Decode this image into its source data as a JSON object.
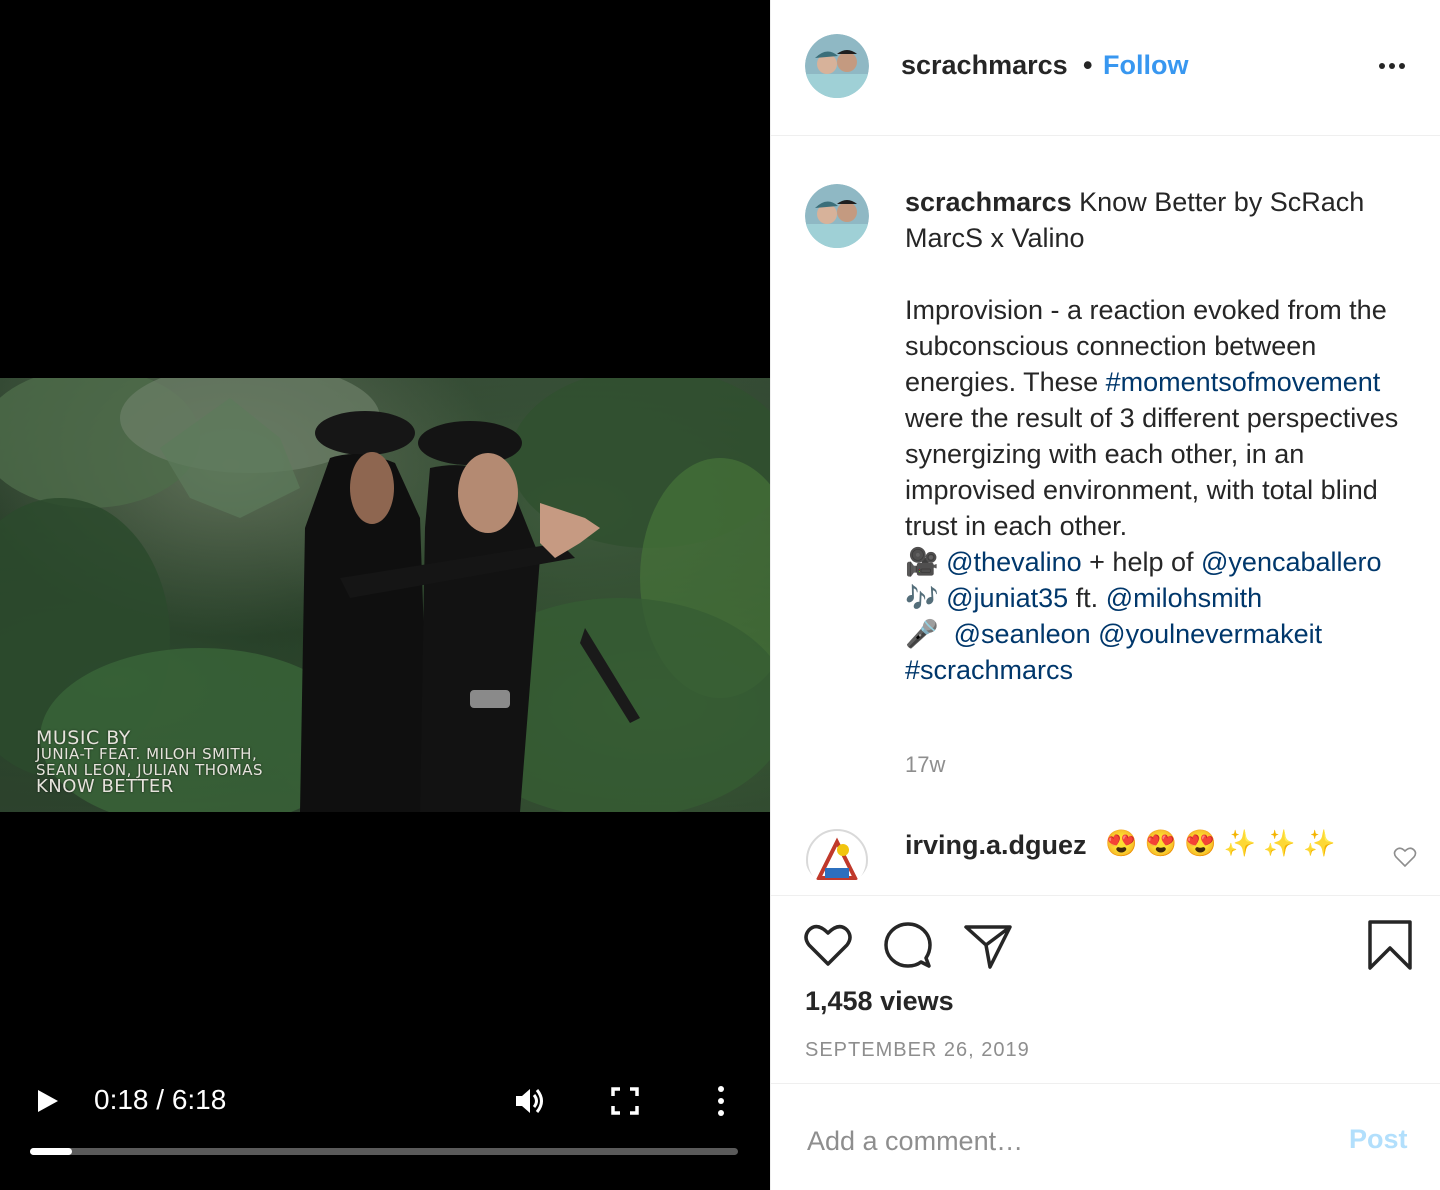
{
  "video": {
    "overlay": {
      "line1": "MUSIC BY",
      "line2": "JUNIA-T FEAT. MILOH SMITH,",
      "line3": "SEAN LEON, JULIAN THOMAS",
      "line4": "KNOW BETTER"
    },
    "time": "0:18 / 6:18",
    "progress": 0.06,
    "icons": [
      "play-icon",
      "volume-icon",
      "fullscreen-icon",
      "more-vertical-icon"
    ]
  },
  "header": {
    "username": "scrachmarcs",
    "separator": "•",
    "follow_label": "Follow",
    "more_icon": "ellipsis-icon"
  },
  "caption": {
    "username": "scrachmarcs",
    "title": "Know Better by ScRach MarcS x Valino",
    "body": "Improvision - a reaction evoked from the subconscious connection between energies. These",
    "hashtag1": "#momentsofmovement",
    "body2": "were the result of 3 different perspectives synergizing with each other, in an improvised environment, with total blind trust in each other.",
    "line_camera": {
      "emoji": "🎥",
      "mention1": "@thevalino",
      "mid": "+ help of",
      "mention2": "@yencaballero"
    },
    "line_music": {
      "emoji": "🎶",
      "mention1": "@juniat35",
      "mid": "ft.",
      "mention2": "@milohsmith"
    },
    "line_mic": {
      "emoji": "🎤",
      "mention1": "@seanleon",
      "mention2": "@youlnevermakeit"
    },
    "hashtag2": "#scrachmarcs",
    "timestamp": "17w"
  },
  "comment": {
    "username": "irving.a.dguez",
    "text": "😍 😍 😍 ✨ ✨ ✨"
  },
  "actions": {
    "views": "1,458 views",
    "date": "SEPTEMBER 26, 2019"
  },
  "comment_box": {
    "placeholder": "Add a comment…",
    "post_label": "Post"
  },
  "colors": {
    "link": "#00376b",
    "follow": "#3897f0",
    "post_disabled": "#b2dffc",
    "muted": "#8e8e8e"
  }
}
